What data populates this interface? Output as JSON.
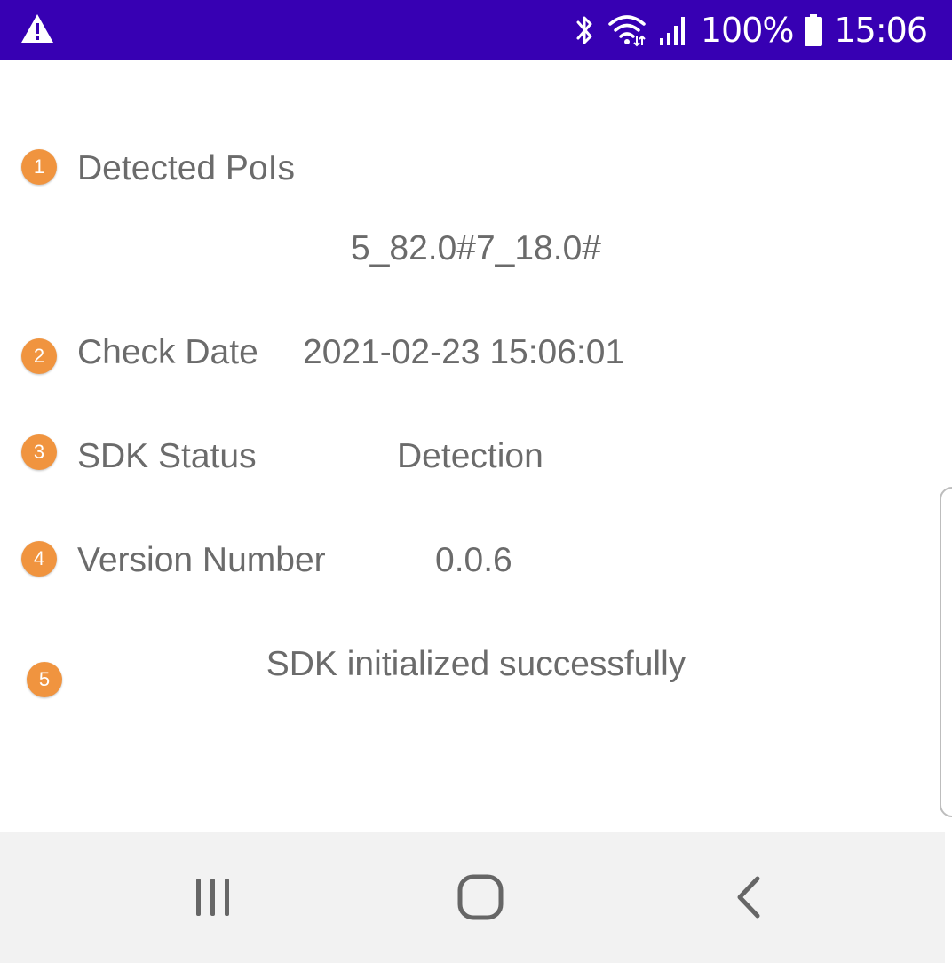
{
  "status_bar": {
    "battery_percent": "100%",
    "time": "15:06",
    "icons": [
      "warning-icon",
      "bluetooth-icon",
      "wifi-icon",
      "cellular-signal-icon",
      "battery-icon"
    ],
    "background_color": "#3700b3"
  },
  "rows": {
    "detected_pois": {
      "badge": "1",
      "label": "Detected PoIs",
      "value": "5_82.0#7_18.0#"
    },
    "check_date": {
      "badge": "2",
      "label": "Check Date",
      "value": "2021-02-23 15:06:01"
    },
    "sdk_status": {
      "badge": "3",
      "label": "SDK Status",
      "value": "Detection"
    },
    "version_number": {
      "badge": "4",
      "label": "Version Number",
      "value": "0.0.6"
    },
    "message": {
      "badge": "5",
      "value": "SDK initialized successfully"
    }
  },
  "badge_color": "#f0943f",
  "nav_bar": {
    "buttons": [
      "recent-apps-icon",
      "home-icon",
      "back-icon"
    ]
  }
}
